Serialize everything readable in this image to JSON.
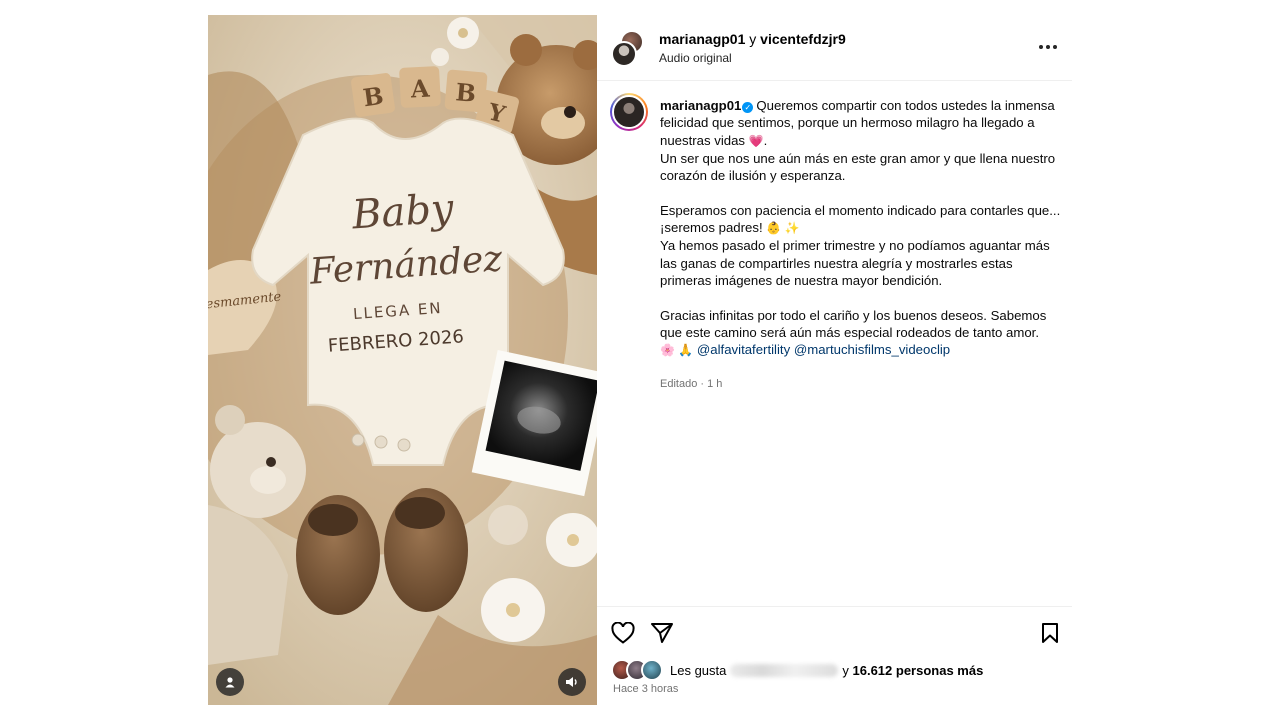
{
  "media": {
    "blocks": [
      "B",
      "A",
      "B",
      "Y"
    ],
    "onesie_line1": "Baby",
    "onesie_line2": "Fernández",
    "onesie_line3": "LLEGA EN",
    "onesie_line4": "FEBRERO 2026",
    "heart_sign": "esmamente",
    "tag_icon": "user-tag-icon",
    "sound_icon": "speaker-icon"
  },
  "header": {
    "user1": "marianagp01",
    "joiner": "y",
    "user2": "vicentefdzjr9",
    "audio": "Audio original",
    "more_icon": "more-horizontal-icon"
  },
  "caption": {
    "username": "marianagp01",
    "p1": "Queremos compartir con todos ustedes la inmensa felicidad que sentimos, porque un hermoso milagro ha llegado a nuestras vidas ",
    "p1_emoji": "💗",
    "p1_end": ".",
    "p2": "Un ser que nos une aún más en este gran amor y que llena nuestro corazón de ilusión y esperanza.",
    "p3": "Esperamos con paciencia el momento indicado para contarles que... ¡seremos padres! ",
    "p3_emoji": "👶 ✨",
    "p4": "Ya hemos pasado el primer trimestre y no podíamos aguantar más las ganas de compartirles nuestra alegría y mostrarles estas primeras imágenes de nuestra mayor bendición.",
    "p5": "Gracias infinitas por todo el cariño y los buenos deseos. Sabemos que este camino será aún más especial rodeados de tanto amor.",
    "p6_emoji": "🌸 🙏",
    "mention1": "@alfavitafertility",
    "mention2": "@martuchisfilms_videoclip",
    "edited": "Editado · 1 h"
  },
  "actions": {
    "like_icon": "heart-icon",
    "share_icon": "send-icon",
    "save_icon": "bookmark-icon",
    "likes_prefix": "Les gusta",
    "likes_joiner": "y",
    "likes_count": "16.612 personas más",
    "time": "Hace 3 horas"
  },
  "colors": {
    "link": "#00376b",
    "verified": "#0095f6",
    "muted": "#737373"
  }
}
